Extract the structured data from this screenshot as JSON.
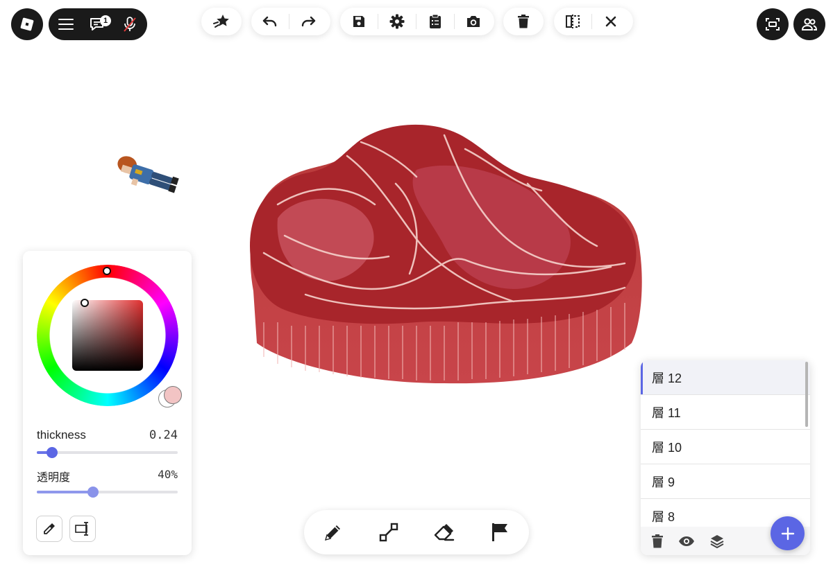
{
  "top_left": {
    "logo_icon": "roblox-logo-icon",
    "menu_icon": "hamburger-menu-icon",
    "chat_icon": "chat-icon",
    "chat_badge": "1",
    "mic_icon": "microphone-muted-icon"
  },
  "toolbar": {
    "groups": [
      [
        "favorite-star-icon"
      ],
      [
        "undo-icon",
        "redo-icon"
      ],
      [
        "save-icon",
        "settings-gear-icon",
        "clipboard-list-icon",
        "camera-icon"
      ],
      [
        "trash-icon"
      ],
      [
        "mirror-split-icon",
        "close-icon"
      ]
    ]
  },
  "top_right": {
    "fullscreen_icon": "screen-capture-icon",
    "people_icon": "people-icon"
  },
  "color_panel": {
    "current_color": "#f2c4c4",
    "secondary_color": "#ffffff",
    "hue_color": "#e03030",
    "thickness_label": "thickness",
    "thickness_value": "0.24",
    "thickness_fraction": 0.24,
    "opacity_label": "透明度",
    "opacity_value": "40%",
    "opacity_fraction": 0.4,
    "eyedropper_icon": "eyedropper-icon",
    "text_tool_icon": "text-cursor-icon"
  },
  "layers_panel": {
    "items": [
      {
        "label": "層 12",
        "active": true
      },
      {
        "label": "層 11",
        "active": false
      },
      {
        "label": "層 10",
        "active": false
      },
      {
        "label": "層 9",
        "active": false
      },
      {
        "label": "層 8",
        "active": false
      }
    ],
    "footer_icons": [
      "trash-icon",
      "eye-icon",
      "layers-icon"
    ],
    "add_icon": "plus-icon",
    "accent": "#5b66e4"
  },
  "bottom_tools": [
    "pencil-icon",
    "line-tool-icon",
    "eraser-icon",
    "flag-icon"
  ],
  "canvas": {
    "drawing": "steak-drawing",
    "avatar": "roblox-avatar-character"
  }
}
